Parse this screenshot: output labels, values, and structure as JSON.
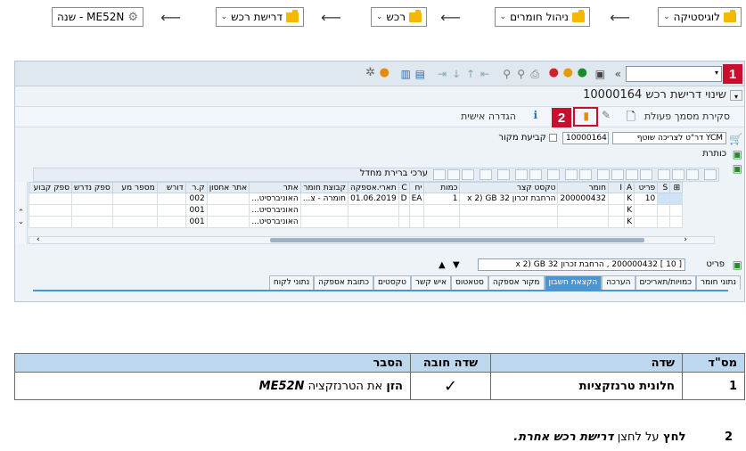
{
  "breadcrumb": {
    "items": [
      "לוגיסטיקה",
      "ניהול חומרים",
      "רכש",
      "דרישת רכש"
    ],
    "last": "ME52N - שנה"
  },
  "sap": {
    "command_field": "",
    "badge1": "1",
    "badge2": "2",
    "title": "שינוי דרישת רכש 10000164",
    "toolbar": {
      "overview": "סקירת מסמך פעולת",
      "personal": "הגדרה אישית"
    },
    "header": {
      "doc_type": "YCM דר\"ט לצריכה שוטף",
      "doc_number": "10000164",
      "source_label": "קביעת מקור",
      "heading_label": "כותרת"
    },
    "grid": {
      "toolbar_label": "ערכי ברירת מחדל",
      "columns": [
        "S",
        "פריט",
        "A",
        "I",
        "חומר",
        "טקסט קצר",
        "כמות",
        "יח",
        "C",
        "תארי.אספקה",
        "קבוצת חומר",
        "אתר",
        "אתר אחסון",
        "ק.ר",
        "דורש",
        "מספר מע",
        "ספק נדרש",
        "ספק קבוע"
      ],
      "rows": [
        [
          "",
          "10",
          "K",
          "",
          "200000432",
          "הרחבת זכרון 32 x 2) GB",
          "1",
          "EA",
          "D",
          "01.06.2019",
          "חומרה - צ...",
          "האוניברסיט...",
          "",
          "002",
          "",
          "",
          "",
          ""
        ],
        [
          "",
          "",
          "K",
          "",
          "",
          "",
          "",
          "",
          "",
          "",
          "",
          "האוניברסיט...",
          "",
          "001",
          "",
          "",
          "",
          ""
        ],
        [
          "",
          "",
          "K",
          "",
          "",
          "",
          "",
          "",
          "",
          "",
          "",
          "האוניברסיט...",
          "",
          "001",
          "",
          "",
          "",
          ""
        ]
      ]
    },
    "item": {
      "label": "פריט",
      "selected": "[ 10 ] 200000432 , הרחבת זכרון 32 x 2) GB"
    },
    "tabs": [
      "נתוני חומר",
      "כמויות/תאריכים",
      "הערכה",
      "הקצאת חשבון",
      "מקור אספקה",
      "סטאטוס",
      "איש קשר",
      "טקסטים",
      "כתובת אספקה",
      "נתוני לקוח"
    ],
    "active_tab": "הקצאת חשבון"
  },
  "instructions": {
    "headers": [
      "מס\"ד",
      "שדה",
      "שדה חובה",
      "הסבר"
    ],
    "rows": [
      {
        "num": "1",
        "field": "חלונית טרנזקציות",
        "mandatory": "✓",
        "explain_prefix": "הזן",
        "explain_mid": "את הטרנזקציה",
        "explain_code": "ME52N"
      }
    ],
    "step2": {
      "num": "2",
      "verb": "לחץ",
      "text": "על לחצן",
      "target": "דרישת רכש אחרת."
    }
  },
  "colors": {
    "badge": "#c8102e",
    "header_bg": "#bdd7ee",
    "active_tab": "#4b96d2",
    "folder": "#f5b800"
  }
}
